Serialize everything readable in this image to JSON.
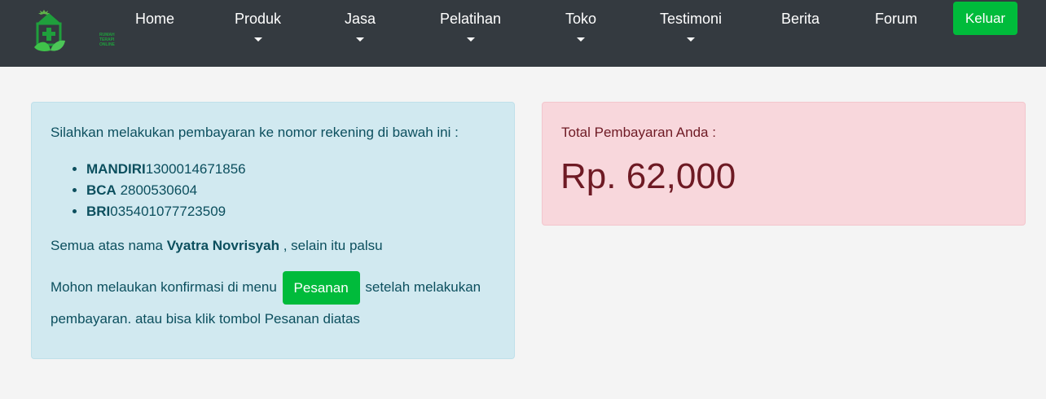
{
  "brand": {
    "logo_text": [
      "RUMAH",
      "TERAPI",
      "ONLINE"
    ]
  },
  "nav": {
    "items": [
      {
        "label": "Home",
        "dropdown": false
      },
      {
        "label": "Produk",
        "dropdown": true
      },
      {
        "label": "Jasa",
        "dropdown": true
      },
      {
        "label": "Pelatihan",
        "dropdown": true
      },
      {
        "label": "Toko",
        "dropdown": true
      },
      {
        "label": "Testimoni",
        "dropdown": true
      },
      {
        "label": "Berita",
        "dropdown": false
      },
      {
        "label": "Forum",
        "dropdown": false
      }
    ],
    "logout_label": "Keluar"
  },
  "payment_info": {
    "intro": "Silahkan melakukan pembayaran ke nomor rekening di bawah ini :",
    "accounts": [
      {
        "bank": "MANDIRI",
        "number": "1300014671856"
      },
      {
        "bank": "BCA",
        "number": " 2800530604"
      },
      {
        "bank": "BRI",
        "number": "035401077723509"
      }
    ],
    "owner_prefix": "Semua atas nama ",
    "owner_name": "Vyatra Novrisyah",
    "owner_suffix": " , selain itu palsu",
    "confirm_prefix": "Mohon melaukan konfirmasi di menu ",
    "confirm_button": "Pesanan",
    "confirm_suffix": " setelah melakukan pembayaran. atau bisa klik tombol Pesanan diatas"
  },
  "total": {
    "label": "Total Pembayaran Anda :",
    "amount": "Rp. 62,000"
  },
  "colors": {
    "navbar": "#343a40",
    "success": "#00bb3b",
    "info_bg": "#d1e9f0",
    "danger_bg": "#f8d7dc"
  }
}
